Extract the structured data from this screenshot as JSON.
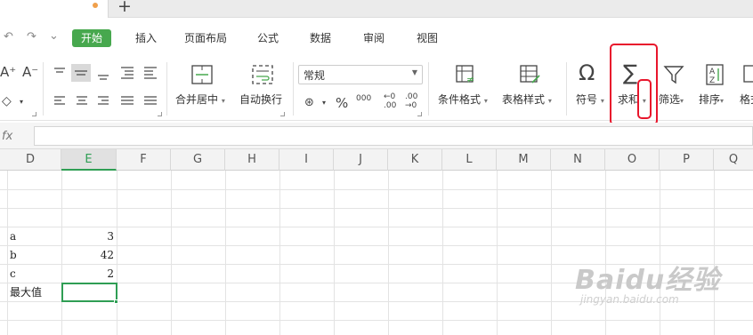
{
  "tabs": {
    "plus": "+"
  },
  "quick": {
    "undo": "↶",
    "redo": "↷",
    "more": "⌄"
  },
  "menus": [
    "开始",
    "插入",
    "页面布局",
    "公式",
    "数据",
    "审阅",
    "视图"
  ],
  "ribbon": {
    "font_grow": "A⁺",
    "font_shrink": "A⁻",
    "merge_label": "合并居中",
    "wrap_label": "自动换行",
    "numfmt_value": "常规",
    "num_glyphs": {
      "currency": "¥",
      "percent": "%",
      "thousands": "000",
      "inc_dec": ".00",
      "dec_dec": ".00"
    },
    "cond_format_label": "条件格式",
    "table_style_label": "表格样式",
    "symbol_label": "符号",
    "sum_label": "求和",
    "filter_label": "筛选",
    "sort_label": "排序",
    "format_label": "格式",
    "omega": "Ω",
    "sigma": "∑"
  },
  "formula_bar": {
    "fx": "fx",
    "value": ""
  },
  "columns": [
    "D",
    "E",
    "F",
    "G",
    "H",
    "I",
    "J",
    "K",
    "L",
    "M",
    "N",
    "O",
    "P",
    "Q"
  ],
  "cells": [
    {
      "col": "D",
      "text": "a"
    },
    {
      "col": "E",
      "text": "3"
    },
    {
      "col": "D",
      "text": "b"
    },
    {
      "col": "E",
      "text": "42"
    },
    {
      "col": "D",
      "text": "c"
    },
    {
      "col": "E",
      "text": "2"
    },
    {
      "col": "D",
      "text": "最大值"
    }
  ],
  "watermark": {
    "brand": "Baidu经验",
    "url": "jingyan.baidu.com"
  },
  "highlight_color": "#e8162c",
  "accent_color": "#47a84e"
}
